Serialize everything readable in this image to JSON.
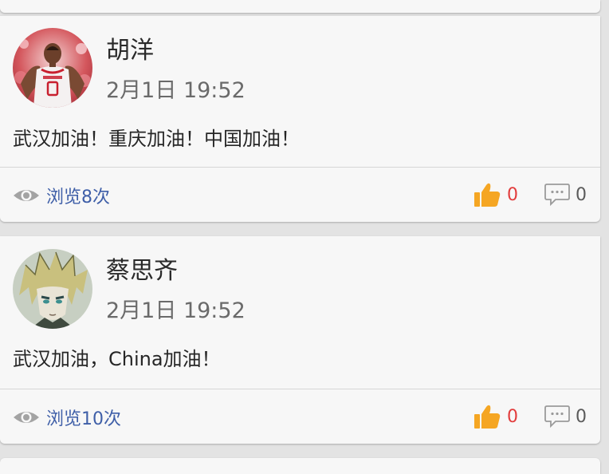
{
  "posts": [
    {
      "author": "胡洋",
      "time": "2月1日 19:52",
      "content": "武汉加油！重庆加油！中国加油！",
      "views": "浏览8次",
      "likes": "0",
      "comments": "0",
      "avatar_icon": "basketball-player-avatar"
    },
    {
      "author": "蔡思齐",
      "time": "2月1日 19:52",
      "content": "武汉加油，China加油！",
      "views": "浏览10次",
      "likes": "0",
      "comments": "0",
      "avatar_icon": "anime-character-avatar"
    }
  ],
  "icons": {
    "views": "eye-icon",
    "like": "thumbs-up-icon",
    "comment": "comment-bubble-icon"
  },
  "colors": {
    "background": "#e3e3e3",
    "card": "#f7f7f7",
    "views_text": "#3f5fa8",
    "like_count": "#e23d3d",
    "like_icon": "#f5a623",
    "icon_gray": "#9a9a9a"
  }
}
